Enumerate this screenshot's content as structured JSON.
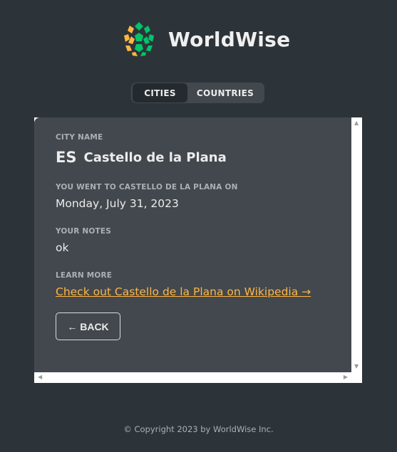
{
  "app": {
    "name": "WorldWise"
  },
  "tabs": [
    {
      "label": "CITIES",
      "active": true
    },
    {
      "label": "COUNTRIES",
      "active": false
    }
  ],
  "city": {
    "name_label": "City name",
    "flag": "ES",
    "name": "Castello de la Plana",
    "visited_label": "You went to Castello de la Plana on",
    "visited_date": "Monday, July 31, 2023",
    "notes_label": "Your notes",
    "notes": "ok",
    "learn_label": "Learn more",
    "wiki_link": "Check out Castello de la Plana on Wikipedia →",
    "back_label": "← BACK"
  },
  "footer": {
    "copyright": "© Copyright 2023 by WorldWise Inc."
  },
  "colors": {
    "background": "#2d3439",
    "panel": "#42484d",
    "link": "#ffb545",
    "logo_green": "#00c46a",
    "logo_yellow": "#ffb545"
  }
}
